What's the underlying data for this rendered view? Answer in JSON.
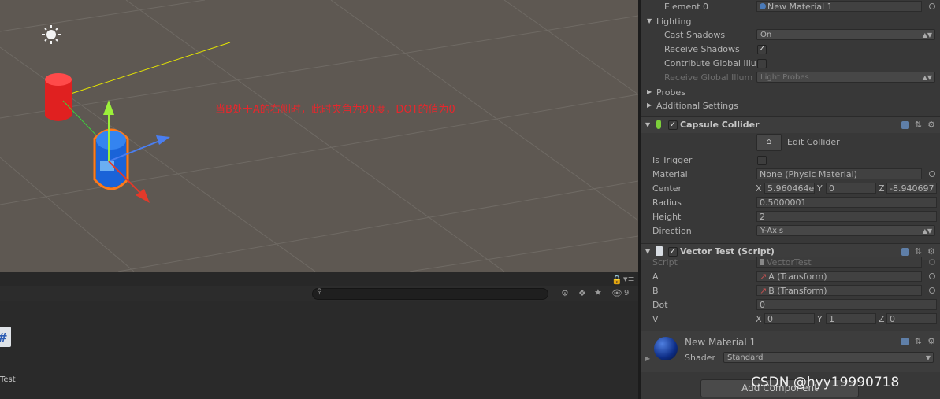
{
  "scene": {
    "annotation": "当B处于A的右侧时，此时夹角为90度，DOT的值为0"
  },
  "project": {
    "file_label": "Test",
    "visible_count": "9"
  },
  "inspector": {
    "element0": {
      "label": "Element 0",
      "value": "New Material 1"
    },
    "lighting": {
      "header": "Lighting",
      "cast_shadows": {
        "label": "Cast Shadows",
        "value": "On"
      },
      "receive_shadows": {
        "label": "Receive Shadows",
        "checked": true
      },
      "contribute_gi": {
        "label": "Contribute Global Illu"
      },
      "receive_gi": {
        "label": "Receive Global Illum",
        "value": "Light Probes"
      }
    },
    "probes": "Probes",
    "additional_settings": "Additional Settings",
    "capsule_collider": {
      "title": "Capsule Collider",
      "edit_collider": "Edit Collider",
      "is_trigger": "Is Trigger",
      "material": {
        "label": "Material",
        "value": "None (Physic Material)"
      },
      "center": {
        "label": "Center",
        "x_label": "X",
        "x": "5.960464e",
        "y_label": "Y",
        "y": "0",
        "z_label": "Z",
        "z": "-8.940697"
      },
      "radius": {
        "label": "Radius",
        "value": "0.5000001"
      },
      "height": {
        "label": "Height",
        "value": "2"
      },
      "direction": {
        "label": "Direction",
        "value": "Y-Axis"
      }
    },
    "vector_test": {
      "title": "Vector Test (Script)",
      "script": {
        "label": "Script",
        "value": "VectorTest"
      },
      "a": {
        "label": "A",
        "value": "A (Transform)"
      },
      "b": {
        "label": "B",
        "value": "B (Transform)"
      },
      "dot": {
        "label": "Dot",
        "value": "0"
      },
      "v": {
        "label": "V",
        "x_label": "X",
        "x": "0",
        "y_label": "Y",
        "y": "1",
        "z_label": "Z",
        "z": "0"
      }
    },
    "material": {
      "name": "New Material 1",
      "shader_label": "Shader",
      "shader_value": "Standard"
    },
    "add_component": "Add Component"
  },
  "watermark": "CSDN @hyy19990718"
}
